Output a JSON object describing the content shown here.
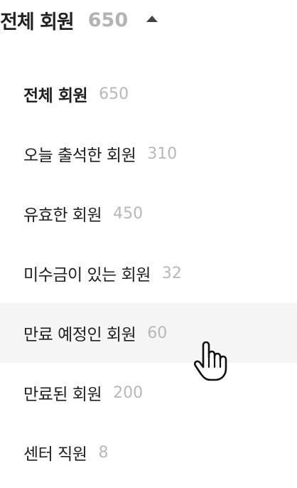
{
  "header": {
    "title": "전체 회원",
    "count": "650",
    "caret_icon": "caret-up-icon"
  },
  "menu": {
    "items": [
      {
        "label": "전체 회원",
        "count": "650",
        "selected": true
      },
      {
        "label": "오늘 출석한 회원",
        "count": "310"
      },
      {
        "label": "유효한 회원",
        "count": "450"
      },
      {
        "label": "미수금이 있는 회원",
        "count": "32"
      },
      {
        "label": "만료 예정인 회원",
        "count": "60",
        "hovered": true
      },
      {
        "label": "만료된 회원",
        "count": "200"
      },
      {
        "label": "센터 직원",
        "count": "8"
      }
    ]
  },
  "cursor": {
    "icon": "hand-pointer-icon"
  },
  "colors": {
    "text": "#222222",
    "count": "#b8b8b8",
    "hover_bg": "#f5f5f5"
  }
}
